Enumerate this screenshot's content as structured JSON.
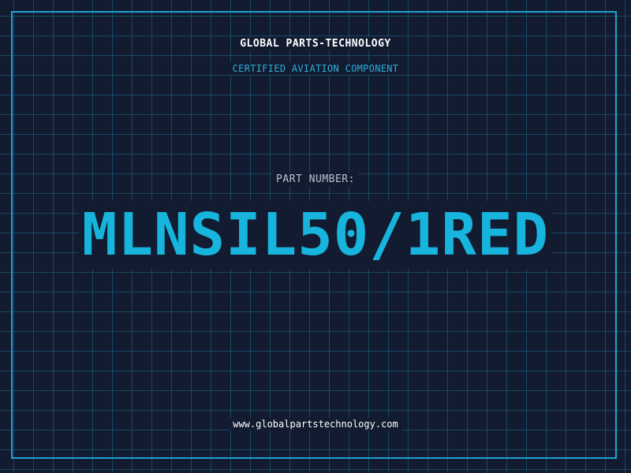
{
  "header": {
    "company": "GLOBAL PARTS-TECHNOLOGY",
    "subtitle": "CERTIFIED AVIATION COMPONENT"
  },
  "main": {
    "part_label": "PART NUMBER:",
    "part_number": "MLNSIL50/1RED"
  },
  "footer": {
    "website": "www.globalpartstechnology.com"
  },
  "colors": {
    "background": "#121b30",
    "grid": "#1e6e8c",
    "accent": "#17b5dd",
    "frame": "#1fa3d1"
  }
}
